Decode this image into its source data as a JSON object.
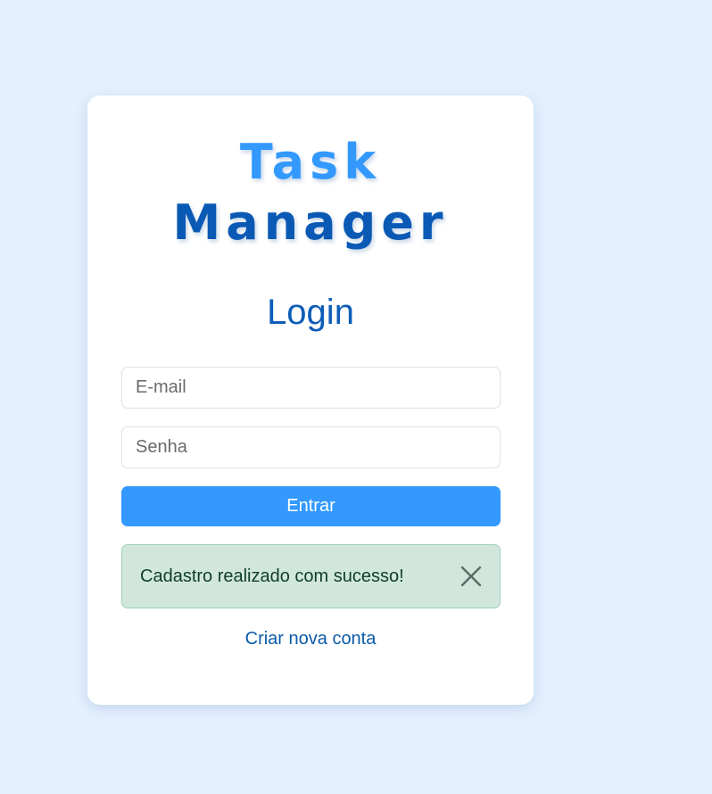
{
  "logo": {
    "line1": "Task",
    "line2": "Manager"
  },
  "login": {
    "title": "Login",
    "email_placeholder": "E-mail",
    "password_placeholder": "Senha",
    "submit_label": "Entrar"
  },
  "alert": {
    "message": "Cadastro realizado com sucesso!",
    "close_icon": "close-icon"
  },
  "links": {
    "create_account": "Criar nova conta"
  },
  "colors": {
    "background": "#e3f0ff",
    "brand_light": "#3399ff",
    "brand_dark": "#0a59b5",
    "success_bg": "#d1e7dd"
  }
}
